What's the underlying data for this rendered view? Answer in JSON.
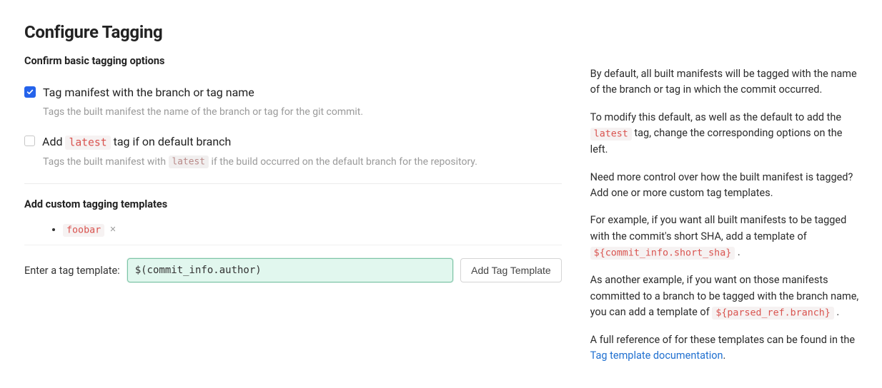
{
  "header": {
    "title": "Configure Tagging",
    "subtitle": "Confirm basic tagging options"
  },
  "options": {
    "tag_branch": {
      "checked": true,
      "label": "Tag manifest with the branch or tag name",
      "description": "Tags the built manifest the name of the branch or tag for the git commit."
    },
    "add_latest": {
      "checked": false,
      "label_pre": "Add ",
      "code": "latest",
      "label_post": " tag if on default branch",
      "description_pre": "Tags the built manifest with ",
      "description_code": "latest",
      "description_post": " if the build occurred on the default branch for the repository."
    }
  },
  "custom_templates": {
    "heading": "Add custom tagging templates",
    "items": [
      "foobar"
    ],
    "remove_glyph": "×",
    "input_label": "Enter a tag template:",
    "input_value": "$(commit_info.author)",
    "add_button_label": "Add Tag Template"
  },
  "help": {
    "p1": "By default, all built manifests will be tagged with the name of the branch or tag in which the commit occurred.",
    "p2_pre": "To modify this default, as well as the default to add the ",
    "p2_code": "latest",
    "p2_post": " tag, change the corresponding options on the left.",
    "p3": "Need more control over how the built manifest is tagged? Add one or more custom tag templates.",
    "p4_pre": "For example, if you want all built manifests to be tagged with the commit's short SHA, add a template of ",
    "p4_code": "${commit_info.short_sha}",
    "p4_post": " .",
    "p5_pre": "As another example, if you want on those manifests committed to a branch to be tagged with the branch name, you can add a template of ",
    "p5_code": "${parsed_ref.branch}",
    "p5_post": " .",
    "p6_pre": "A full reference of for these templates can be found in the ",
    "p6_link": "Tag template documentation",
    "p6_post": "."
  }
}
